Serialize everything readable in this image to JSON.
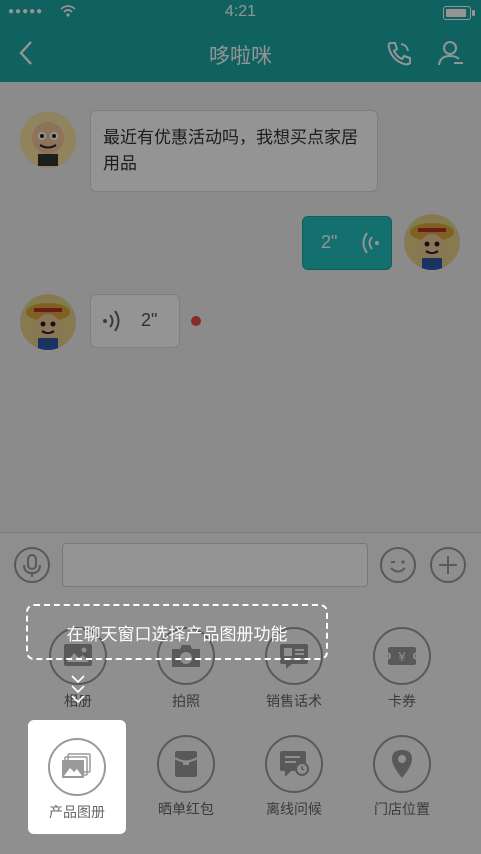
{
  "status_bar": {
    "time": "4:21",
    "signal_dots": "●●●●●"
  },
  "nav": {
    "title": "哆啦咪"
  },
  "messages": {
    "incoming_text": "最近有优惠活动吗，我想买点家居用品",
    "outgoing_voice_duration": "2\"",
    "incoming_voice_duration": "2\""
  },
  "input": {
    "value": "",
    "placeholder": ""
  },
  "tools_row1": [
    {
      "label": "相册",
      "icon": "image-icon"
    },
    {
      "label": "拍照",
      "icon": "camera-icon"
    },
    {
      "label": "销售话术",
      "icon": "script-icon"
    },
    {
      "label": "卡券",
      "icon": "coupon-icon"
    }
  ],
  "tools_row2": [
    {
      "label": "产品图册",
      "icon": "gallery-icon"
    },
    {
      "label": "晒单红包",
      "icon": "red-packet-icon"
    },
    {
      "label": "离线问候",
      "icon": "offline-message-icon"
    },
    {
      "label": "门店位置",
      "icon": "location-icon"
    }
  ],
  "guide": {
    "tip": "在聊天窗口选择产品图册功能"
  },
  "colors": {
    "brand": "#1aa9a6",
    "voice_bubble": "#23c1c0",
    "unread_dot": "#e94b4b"
  }
}
